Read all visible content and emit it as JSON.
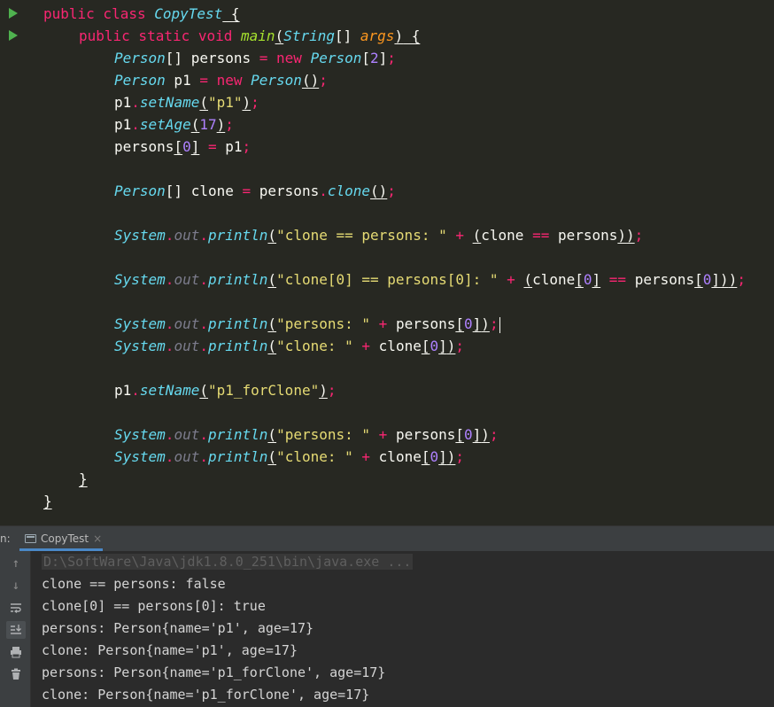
{
  "code": {
    "line1": {
      "kw": "public class ",
      "cls": "CopyTest",
      "brace": " {"
    },
    "line2": {
      "kw": "public static void ",
      "method": "main",
      "lp": "(",
      "type": "String",
      "arr": "[]",
      "param": "args",
      "rp": ")",
      "brace": " {"
    },
    "line3": {
      "type": "Person",
      "arr": "[]",
      "var": " persons ",
      "eq": "=",
      "kw": " new ",
      "type2": "Person",
      "lb": "[",
      "num": "2",
      "rb": "]",
      "semi": ";"
    },
    "line4": {
      "type": "Person",
      "var": " p1 ",
      "eq": "=",
      "kw": " new ",
      "type2": "Person",
      "parens": "()",
      "semi": ";"
    },
    "line5": {
      "obj": "p1",
      "dot": ".",
      "method": "setName",
      "lp": "(",
      "str": "\"p1\"",
      "rp": ")",
      "semi": ";"
    },
    "line6": {
      "obj": "p1",
      "dot": ".",
      "method": "setAge",
      "lp": "(",
      "num": "17",
      "rp": ")",
      "semi": ";"
    },
    "line7": {
      "obj": "persons",
      "lb": "[",
      "num": "0",
      "rb": "]",
      "eq": " = ",
      "val": "p1",
      "semi": ";"
    },
    "line9": {
      "type": "Person",
      "arr": "[]",
      "var": " clone ",
      "eq": "=",
      "obj": " persons",
      "dot": ".",
      "method": "clone",
      "parens": "()",
      "semi": ";"
    },
    "line11": {
      "sys": "System",
      "dot1": ".",
      "out": "out",
      "dot2": ".",
      "method": "println",
      "lp": "(",
      "str": "\"clone == persons: \"",
      "plus": " + ",
      "lp2": "(",
      "a": "clone ",
      "op": "==",
      "b": " persons",
      "rp2": ")",
      "rp": ")",
      "semi": ";"
    },
    "line13": {
      "sys": "System",
      "dot1": ".",
      "out": "out",
      "dot2": ".",
      "method": "println",
      "lp": "(",
      "str": "\"clone[0] == persons[0]: \"",
      "plus": " + ",
      "lp2": "(",
      "a": "clone",
      "lb1": "[",
      "n1": "0",
      "rb1": "]",
      "op": " == ",
      "b": "persons",
      "lb2": "[",
      "n2": "0",
      "rb2": "]",
      "rp2": ")",
      "rp": ")",
      "semi": ";"
    },
    "line15": {
      "sys": "System",
      "dot1": ".",
      "out": "out",
      "dot2": ".",
      "method": "println",
      "lp": "(",
      "str": "\"persons: \"",
      "plus": " + ",
      "a": "persons",
      "lb": "[",
      "n": "0",
      "rb": "]",
      "rp": ")",
      "semi": ";"
    },
    "line16": {
      "sys": "System",
      "dot1": ".",
      "out": "out",
      "dot2": ".",
      "method": "println",
      "lp": "(",
      "str": "\"clone: \"",
      "plus": " + ",
      "a": "clone",
      "lb": "[",
      "n": "0",
      "rb": "]",
      "rp": ")",
      "semi": ";"
    },
    "line18": {
      "obj": "p1",
      "dot": ".",
      "method": "setName",
      "lp": "(",
      "str": "\"p1_forClone\"",
      "rp": ")",
      "semi": ";"
    },
    "line20": {
      "sys": "System",
      "dot1": ".",
      "out": "out",
      "dot2": ".",
      "method": "println",
      "lp": "(",
      "str": "\"persons: \"",
      "plus": " + ",
      "a": "persons",
      "lb": "[",
      "n": "0",
      "rb": "]",
      "rp": ")",
      "semi": ";"
    },
    "line21": {
      "sys": "System",
      "dot1": ".",
      "out": "out",
      "dot2": ".",
      "method": "println",
      "lp": "(",
      "str": "\"clone: \"",
      "plus": " + ",
      "a": "clone",
      "lb": "[",
      "n": "0",
      "rb": "]",
      "rp": ")",
      "semi": ";"
    },
    "line22": {
      "brace": "}"
    },
    "line23": {
      "brace": "}"
    }
  },
  "run_panel": {
    "prefix": "n:",
    "tab_label": "CopyTest",
    "close_glyph": "×",
    "toolbar_icons": [
      "up-arrow-icon",
      "down-arrow-icon",
      "soft-wrap-icon",
      "scroll-to-end-icon",
      "print-icon",
      "trash-icon"
    ]
  },
  "console": {
    "command": "D:\\SoftWare\\Java\\jdk1.8.0_251\\bin\\java.exe ...",
    "lines": [
      "clone == persons: false",
      "clone[0] == persons[0]: true",
      "persons: Person{name='p1', age=17}",
      "clone: Person{name='p1', age=17}",
      "persons: Person{name='p1_forClone', age=17}",
      "clone: Person{name='p1_forClone', age=17}"
    ]
  },
  "colors": {
    "editor_bg": "#272822",
    "keyword": "#f92672",
    "type": "#66d9ef",
    "method": "#a6e22e",
    "param": "#fd971f",
    "string": "#e6db74",
    "number": "#ae81ff",
    "run_icon": "#4fb24f"
  }
}
